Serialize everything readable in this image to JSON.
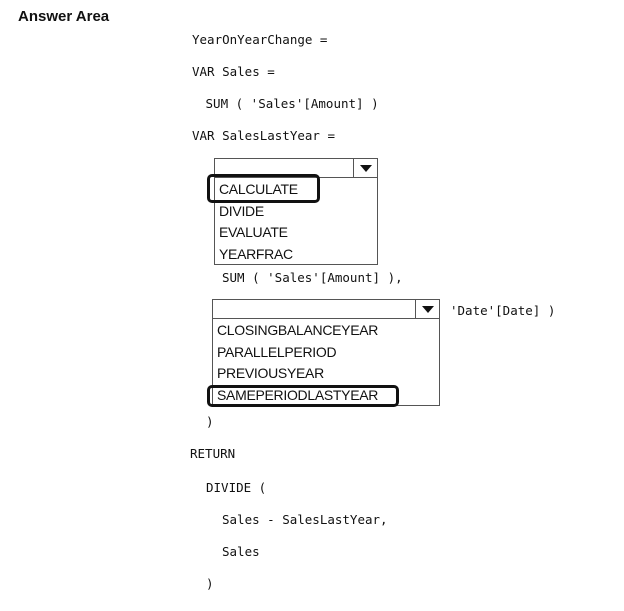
{
  "header": {
    "title": "Answer Area"
  },
  "code": {
    "line1": "YearOnYearChange =",
    "line2": "VAR Sales =",
    "line3": " SUM ( 'Sales'[Amount] )",
    "line4": "VAR SalesLastYear =",
    "line5": "SUM ( 'Sales'[Amount] ),",
    "line6": "'Date'[Date] )",
    "line7": ")",
    "line8": "RETURN",
    "line9": "DIVIDE (",
    "line10": "Sales - SalesLastYear,",
    "line11": "Sales",
    "line12": ")"
  },
  "dropdown1": {
    "selected": "CALCULATE",
    "options": [
      "CALCULATE",
      "DIVIDE",
      "EVALUATE",
      "YEARFRAC"
    ]
  },
  "dropdown2": {
    "selected": "SAMEPERIODLASTYEAR",
    "options": [
      "CLOSINGBALANCEYEAR",
      "PARALLELPERIOD",
      "PREVIOUSYEAR",
      "SAMEPERIODLASTYEAR"
    ]
  },
  "icons": {
    "dropdown_arrow": "chevron-down-icon"
  }
}
